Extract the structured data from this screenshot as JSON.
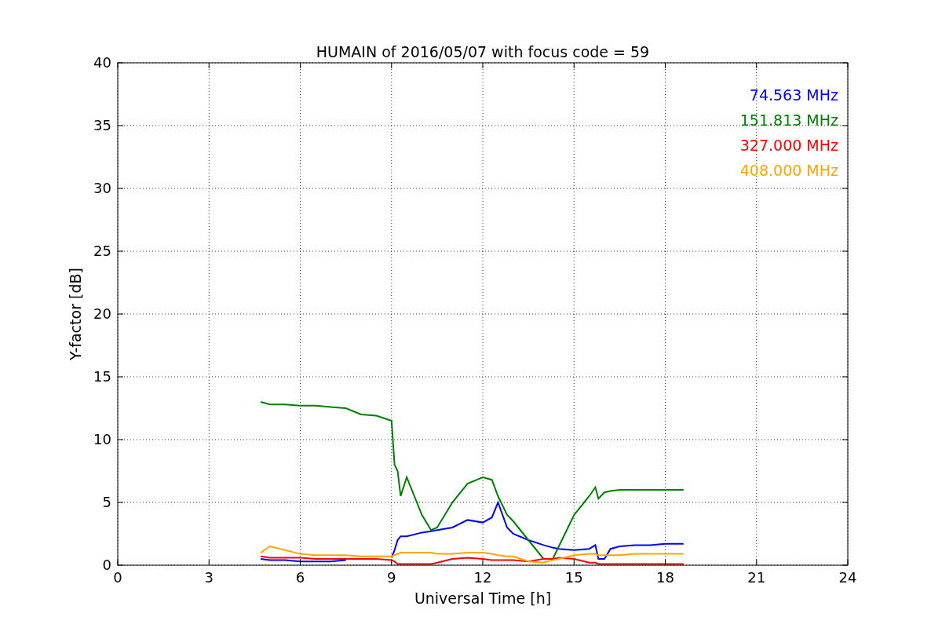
{
  "figure": {
    "chart_data": {
      "type": "line",
      "grid": true,
      "title": "HUMAIN of 2016/05/07 with focus code = 59",
      "xlabel": "Universal Time [h]",
      "ylabel": "Y-factor [dB]",
      "xlim": [
        0,
        24
      ],
      "ylim": [
        0,
        40
      ],
      "xticks": [
        0,
        3,
        6,
        9,
        12,
        15,
        18,
        21,
        24
      ],
      "yticks": [
        0,
        5,
        10,
        15,
        20,
        25,
        30,
        35,
        40
      ],
      "x": [
        4.7,
        5,
        5.5,
        6,
        6.5,
        7,
        7.5,
        8,
        8.5,
        9,
        9.1,
        9.2,
        9.3,
        9.5,
        10,
        10.3,
        10.5,
        11,
        11.5,
        12,
        12.3,
        12.5,
        12.8,
        13,
        13.5,
        14,
        14.3,
        14.5,
        15,
        15.5,
        15.7,
        15.8,
        16,
        16.2,
        16.5,
        17,
        17.5,
        18,
        18.6
      ],
      "series": [
        {
          "name": "74.563 MHz",
          "color": "#0000ff",
          "values": [
            0.5,
            0.4,
            0.4,
            0.3,
            0.3,
            0.3,
            0.4,
            null,
            null,
            0.6,
            1.2,
            2,
            2.3,
            2.3,
            2.6,
            2.7,
            2.8,
            3,
            3.6,
            3.4,
            3.8,
            5,
            3,
            2.5,
            2,
            1.6,
            1.4,
            1.3,
            1.2,
            1.3,
            1.6,
            0.5,
            0.5,
            1.3,
            1.5,
            1.6,
            1.6,
            1.7,
            1.7
          ]
        },
        {
          "name": "151.813 MHz",
          "color": "#008000",
          "values": [
            13,
            12.8,
            12.8,
            12.7,
            12.7,
            12.6,
            12.5,
            12,
            11.9,
            11.5,
            8,
            7.5,
            5.5,
            7,
            4,
            2.8,
            3,
            5,
            6.5,
            7,
            6.8,
            5.5,
            4,
            3.5,
            2,
            0.5,
            0.5,
            1.5,
            4,
            5.5,
            6.2,
            5.3,
            5.8,
            5.9,
            6,
            6,
            6,
            6,
            6
          ]
        },
        {
          "name": "327.000 MHz",
          "color": "#ff0000",
          "values": [
            0.7,
            0.6,
            0.6,
            0.6,
            0.5,
            0.5,
            0.5,
            0.5,
            0.5,
            0.4,
            0.3,
            0.1,
            0.1,
            0.1,
            0.1,
            0.1,
            0.2,
            0.5,
            0.6,
            0.5,
            0.4,
            0.4,
            0.4,
            0.4,
            0.3,
            0.5,
            0.5,
            0.6,
            0.5,
            0.2,
            0.2,
            0.1,
            0.1,
            0.1,
            0.1,
            0.1,
            0.1,
            0.1,
            0.1
          ]
        },
        {
          "name": "408.000 MHz",
          "color": "#ffa500",
          "values": [
            1,
            1.5,
            1.2,
            0.9,
            0.8,
            0.8,
            0.8,
            0.7,
            0.7,
            0.7,
            0.8,
            0.9,
            1,
            1,
            1,
            1,
            0.9,
            0.9,
            1,
            1,
            0.9,
            0.8,
            0.7,
            0.7,
            0.3,
            0.2,
            0.4,
            0.5,
            0.8,
            0.9,
            0.9,
            0.8,
            0.8,
            0.8,
            0.8,
            0.9,
            0.9,
            0.9,
            0.9
          ]
        }
      ]
    }
  }
}
